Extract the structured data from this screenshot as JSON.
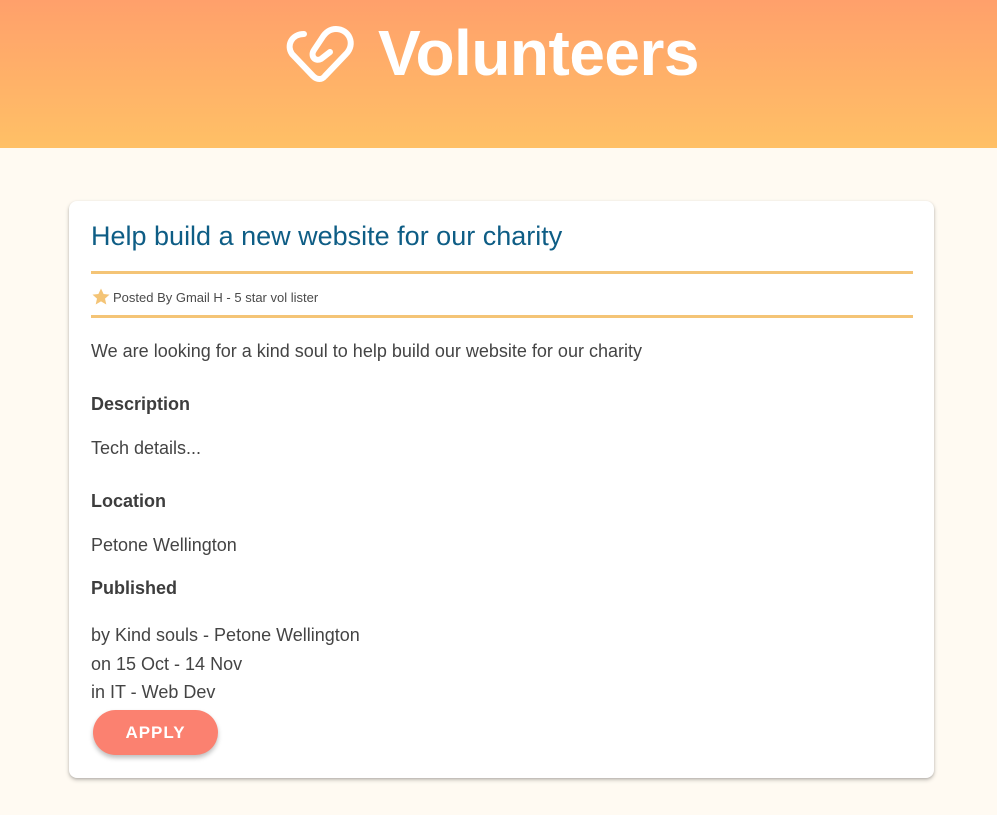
{
  "header": {
    "brand_text": "Volunteers",
    "logo_icon": "heart-icon",
    "gradient_top": "#ffa06b",
    "gradient_bottom": "#ffc066"
  },
  "listing": {
    "title": "Help build a new website for our charity",
    "posted_by": "Posted By Gmail H - 5 star vol lister",
    "summary": "We are looking for a kind soul to help build our website for our charity",
    "description_label": "Description",
    "description": "Tech details...",
    "location_label": "Location",
    "location": "Petone Wellington",
    "published_label": "Published",
    "published_by": "by Kind souls - Petone Wellington",
    "published_dates": "on 15 Oct - 14 Nov",
    "published_category": "in IT - Web Dev",
    "apply_label": "APPLY"
  },
  "colors": {
    "page_background": "#fffaf2",
    "title": "#0e5d85",
    "divider": "#f4c476",
    "star": "#f4c476",
    "apply_button": "#fb8170"
  }
}
